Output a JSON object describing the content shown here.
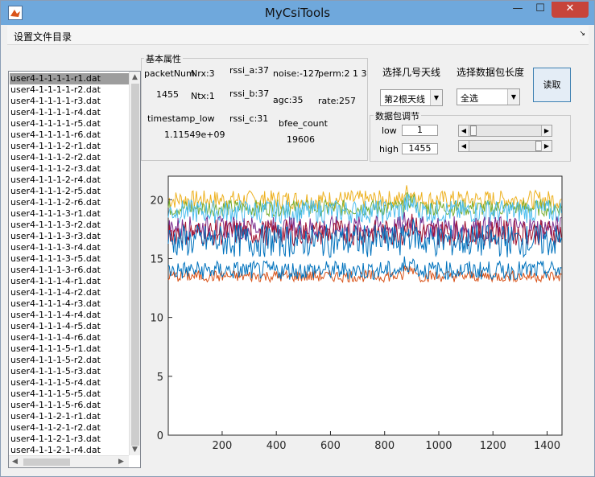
{
  "app": {
    "title": "MyCsiTools"
  },
  "window_controls": {
    "minimize": "—",
    "maximize": "☐",
    "close": "✕"
  },
  "menu": {
    "items": [
      "设置文件目录"
    ]
  },
  "file_list": {
    "selected_index": 0,
    "items": [
      "user4-1-1-1-1-r1.dat",
      "user4-1-1-1-1-r2.dat",
      "user4-1-1-1-1-r3.dat",
      "user4-1-1-1-1-r4.dat",
      "user4-1-1-1-1-r5.dat",
      "user4-1-1-1-1-r6.dat",
      "user4-1-1-1-2-r1.dat",
      "user4-1-1-1-2-r2.dat",
      "user4-1-1-1-2-r3.dat",
      "user4-1-1-1-2-r4.dat",
      "user4-1-1-1-2-r5.dat",
      "user4-1-1-1-2-r6.dat",
      "user4-1-1-1-3-r1.dat",
      "user4-1-1-1-3-r2.dat",
      "user4-1-1-1-3-r3.dat",
      "user4-1-1-1-3-r4.dat",
      "user4-1-1-1-3-r5.dat",
      "user4-1-1-1-3-r6.dat",
      "user4-1-1-1-4-r1.dat",
      "user4-1-1-1-4-r2.dat",
      "user4-1-1-1-4-r3.dat",
      "user4-1-1-1-4-r4.dat",
      "user4-1-1-1-4-r5.dat",
      "user4-1-1-1-4-r6.dat",
      "user4-1-1-1-5-r1.dat",
      "user4-1-1-1-5-r2.dat",
      "user4-1-1-1-5-r3.dat",
      "user4-1-1-1-5-r4.dat",
      "user4-1-1-1-5-r5.dat",
      "user4-1-1-1-5-r6.dat",
      "user4-1-1-2-1-r1.dat",
      "user4-1-1-2-1-r2.dat",
      "user4-1-1-2-1-r3.dat",
      "user4-1-1-2-1-r4.dat"
    ]
  },
  "props": {
    "group_title": "基本属性",
    "packetnum_label": "packetNum",
    "packetnum_value": "1455",
    "nrx": "Nrx:3",
    "ntx": "Ntx:1",
    "rssi_a": "rssi_a:37",
    "rssi_b": "rssi_b:37",
    "rssi_c": "rssi_c:31",
    "noise": "noise:-127",
    "perm": "perm:2  1  3",
    "agc": "agc:35",
    "rate": "rate:257",
    "timestamp_label": "timestamp_low",
    "timestamp_value": "1.11549e+09",
    "bfee_label": "bfee_count",
    "bfee_value": "19606"
  },
  "controls": {
    "antenna_label": "选择几号天线",
    "antenna_value": "第2根天线",
    "length_label": "选择数据包长度",
    "length_value": "全选",
    "read_button": "读取",
    "adjust_title": "数据包调节",
    "low_label": "low",
    "low_value": "1",
    "high_label": "high",
    "high_value": "1455",
    "low_slider_fraction": 0.0,
    "high_slider_fraction": 1.0
  },
  "chart_data": {
    "type": "line",
    "title": "",
    "xlabel": "",
    "ylabel": "",
    "xlim": [
      1,
      1455
    ],
    "ylim": [
      0,
      22
    ],
    "xticks": [
      200,
      400,
      600,
      800,
      1000,
      1200,
      1400
    ],
    "yticks": [
      0,
      5,
      10,
      15,
      20
    ],
    "grid": false,
    "series": [
      {
        "color": "#edb120",
        "mean": 20.0,
        "spread": 0.8
      },
      {
        "color": "#77ac30",
        "mean": 19.3,
        "spread": 0.7
      },
      {
        "color": "#4dbeee",
        "mean": 19.0,
        "spread": 1.0
      },
      {
        "color": "#7e2f8e",
        "mean": 17.6,
        "spread": 1.0
      },
      {
        "color": "#a2142f",
        "mean": 17.2,
        "spread": 1.1
      },
      {
        "color": "#0072bd",
        "mean": 16.5,
        "spread": 1.4
      },
      {
        "color": "#d95319",
        "mean": 13.5,
        "spread": 0.5
      },
      {
        "color": "#0072bd",
        "mean": 14.0,
        "spread": 0.8
      }
    ]
  }
}
